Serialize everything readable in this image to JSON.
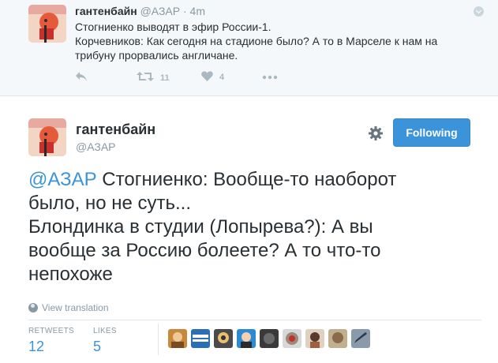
{
  "parent_tweet": {
    "name": "гантенбайн",
    "handle": "@АЗАР",
    "separator": "·",
    "time": "4m",
    "text_lines": [
      "Стогниенко выводят в эфир России-1.",
      "Корчевников: Как сегодня на стадионе было? А то в Марселе к нам на",
      "трибуну прорвались англичане."
    ],
    "actions": {
      "reply_icon": "reply-icon",
      "retweet_icon": "retweet-icon",
      "retweet_count": "11",
      "like_icon": "heart-icon",
      "like_count": "4",
      "more_icon": "more-icon"
    }
  },
  "main_tweet": {
    "name": "гантенбайн",
    "handle": "@АЗАР",
    "follow_label": "Following",
    "mention": "@АЗАР",
    "text_lines": [
      "Стогниенко: Вообще-то наоборот",
      "было, но не суть...",
      "Блондинка в студии (Лопырева?): А вы",
      "вообще за Россию болеете? А то что-то",
      "непохоже"
    ],
    "view_translation": "View translation",
    "stats": {
      "retweets_label": "RETWEETS",
      "retweets_value": "12",
      "likes_label": "LIKES",
      "likes_value": "5"
    }
  },
  "colors": {
    "accent": "#3b94d9",
    "muted": "#8899a6",
    "text": "#292f33",
    "parent_bg": "#f5f8fa"
  }
}
